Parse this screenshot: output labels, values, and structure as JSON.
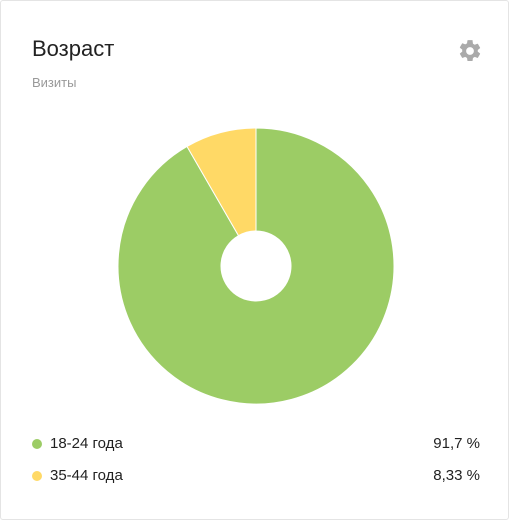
{
  "widget": {
    "title": "Возраст",
    "subtitle": "Визиты"
  },
  "icons": {
    "settings": "gear-icon"
  },
  "chart_data": {
    "type": "pie",
    "donut": true,
    "categories": [
      "18-24 года",
      "35-44 года"
    ],
    "values": [
      91.7,
      8.33
    ],
    "value_labels": [
      "91,7 %",
      "8,33 %"
    ],
    "colors": [
      "#9ccc65",
      "#ffd966"
    ],
    "legend_position": "bottom"
  }
}
